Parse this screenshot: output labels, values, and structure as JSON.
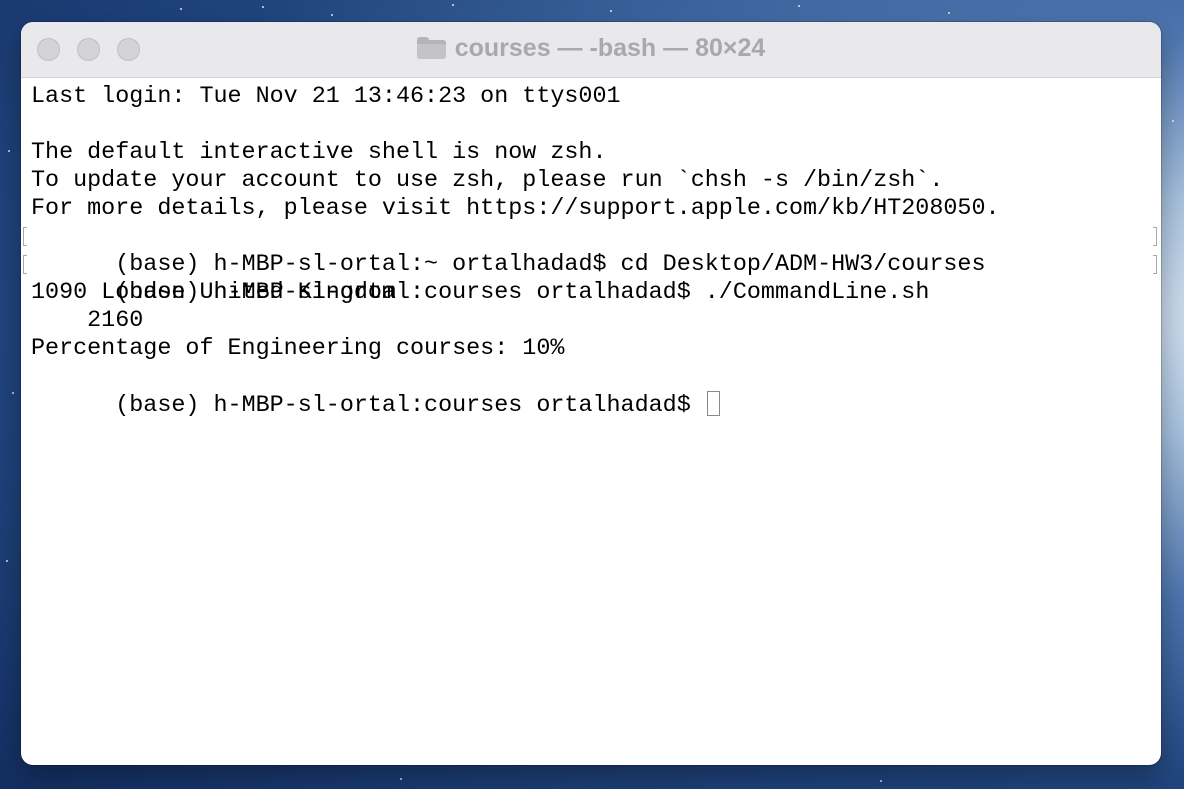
{
  "window": {
    "title": "courses — -bash — 80×24",
    "title_icon": "folder-icon"
  },
  "terminal": {
    "lines": [
      "Last login: Tue Nov 21 13:46:23 on ttys001",
      "",
      "The default interactive shell is now zsh.",
      "To update your account to use zsh, please run `chsh -s /bin/zsh`.",
      "For more details, please visit https://support.apple.com/kb/HT208050.",
      "(base) h-MBP-sl-ortal:~ ortalhadad$ cd Desktop/ADM-HW3/courses",
      "(base) h-MBP-sl-ortal:courses ortalhadad$ ./CommandLine.sh",
      "1090 London United Kingdom",
      "    2160",
      "Percentage of Engineering courses: 10%",
      "(base) h-MBP-sl-ortal:courses ortalhadad$ "
    ]
  },
  "colors": {
    "titlebar_bg": "#e9e9eb",
    "title_text": "#a9a9ab",
    "terminal_bg": "#ffffff",
    "terminal_text": "#000000"
  }
}
